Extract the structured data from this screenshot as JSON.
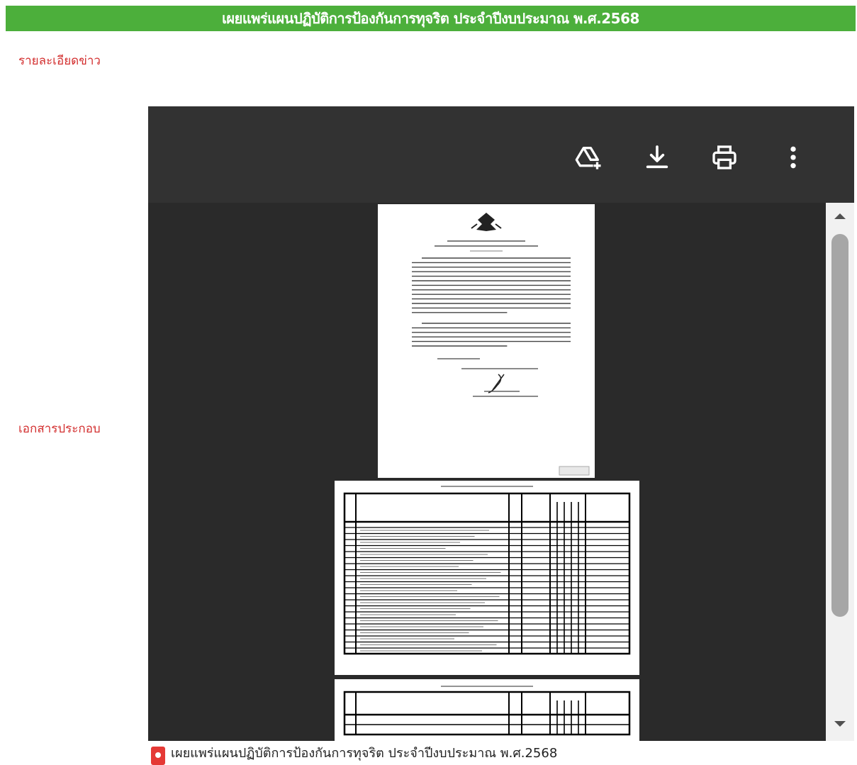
{
  "header": {
    "title": "เผยแพร่แผนปฏิบัติการป้องกันการทุจริต ประจำปีงบประมาณ พ.ศ.2568"
  },
  "labels": {
    "details": "รายละเอียดข่าว",
    "attachments": "เอกสารประกอบ"
  },
  "viewer": {
    "toolbar": {
      "add_to_drive_icon": "drive-add-icon",
      "download_icon": "download-icon",
      "print_icon": "print-icon",
      "more_icon": "more-vert-icon"
    }
  },
  "attachment": {
    "file_name": "เผยแพร่แผนปฏิบัติการป้องกันการทุจริต ประจำปีงบประมาณ พ.ศ.2568",
    "icon": "pdf-icon"
  },
  "colors": {
    "header_bg": "#4caf3b",
    "label_red": "#d32f2f",
    "viewer_bg": "#2a2a2a",
    "toolbar_bg": "#323232"
  }
}
